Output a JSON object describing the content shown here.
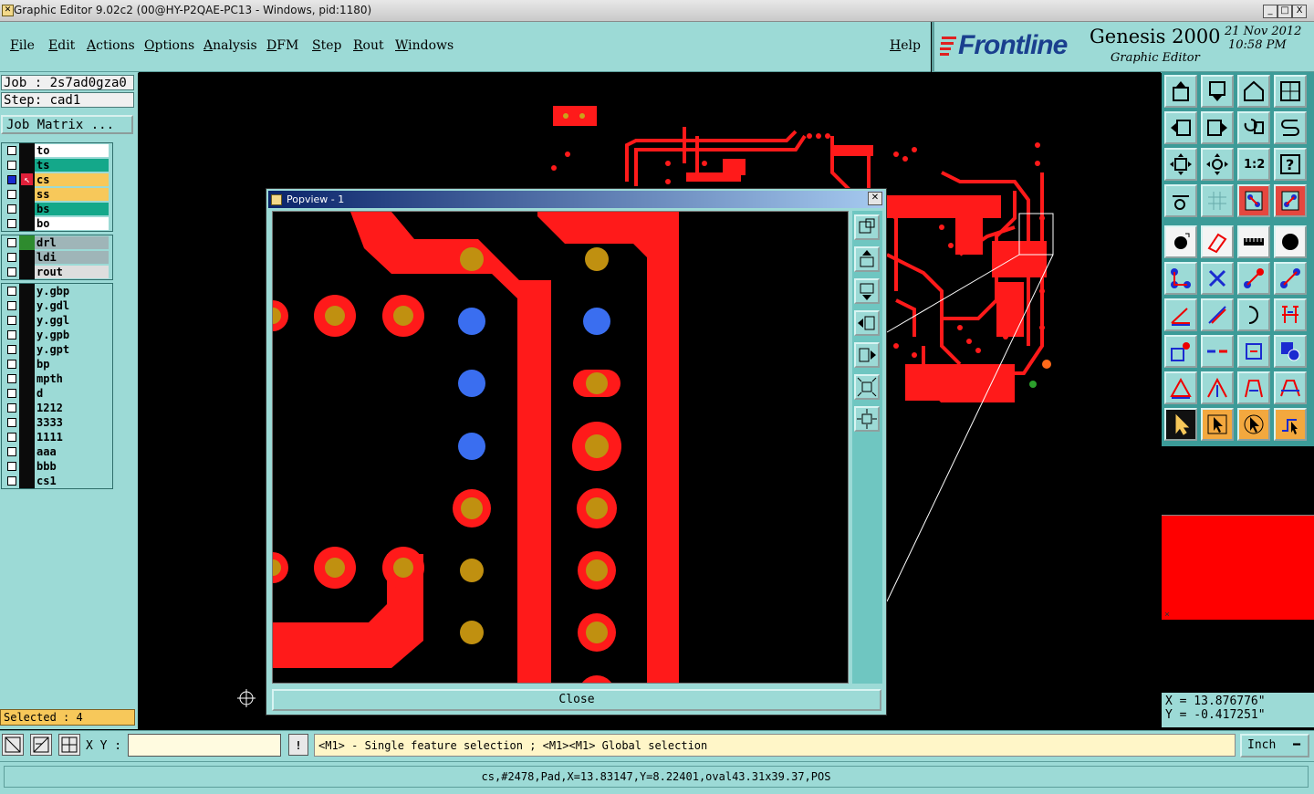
{
  "window": {
    "title": "Graphic Editor 9.02c2 (00@HY-P2QAE-PC13 - Windows, pid:1180)",
    "controls": [
      "_",
      "□",
      "X"
    ]
  },
  "menubar": {
    "items": [
      "File",
      "Edit",
      "Actions",
      "Options",
      "Analysis",
      "DFM",
      "Step",
      "Rout",
      "Windows"
    ],
    "help": "Help"
  },
  "brand": {
    "logo": "Frontline",
    "product": "Genesis 2000",
    "subtitle": "Graphic Editor",
    "date": "21 Nov 2012",
    "time": "10:58 PM"
  },
  "left_panel": {
    "job": "Job : 2s7ad0gza0",
    "step": "Step: cad1",
    "job_matrix": "Job Matrix ...",
    "layer_groups": [
      [
        {
          "name": "to",
          "color": "#ffffff",
          "checked": false
        },
        {
          "name": "ts",
          "color": "#14a88a",
          "checked": false
        },
        {
          "name": "cs",
          "color": "#f7c85a",
          "checked": true
        },
        {
          "name": "ss",
          "color": "#f7c85a",
          "checked": false
        },
        {
          "name": "bs",
          "color": "#14a88a",
          "checked": false
        },
        {
          "name": "bo",
          "color": "#ffffff",
          "checked": false
        }
      ],
      [
        {
          "name": "drl",
          "color": "#9fb5b8",
          "checked": false
        },
        {
          "name": "ldi",
          "color": "#9fb5b8",
          "checked": false
        },
        {
          "name": "rout",
          "color": "#dedede",
          "checked": false
        }
      ],
      [
        {
          "name": "y.gbp",
          "color": "#9cdad6",
          "checked": false
        },
        {
          "name": "y.gdl",
          "color": "#9cdad6",
          "checked": false
        },
        {
          "name": "y.ggl",
          "color": "#9cdad6",
          "checked": false
        },
        {
          "name": "y.gpb",
          "color": "#9cdad6",
          "checked": false
        },
        {
          "name": "y.gpt",
          "color": "#9cdad6",
          "checked": false
        },
        {
          "name": "bp",
          "color": "#9cdad6",
          "checked": false
        },
        {
          "name": "mpth",
          "color": "#9cdad6",
          "checked": false
        },
        {
          "name": "d",
          "color": "#9cdad6",
          "checked": false
        },
        {
          "name": "1212",
          "color": "#9cdad6",
          "checked": false
        },
        {
          "name": "3333",
          "color": "#9cdad6",
          "checked": false
        },
        {
          "name": "1111",
          "color": "#9cdad6",
          "checked": false
        },
        {
          "name": "aaa",
          "color": "#9cdad6",
          "checked": false
        },
        {
          "name": "bbb",
          "color": "#9cdad6",
          "checked": false
        },
        {
          "name": "cs1",
          "color": "#9cdad6",
          "checked": false
        }
      ]
    ],
    "selected": "Selected : 4"
  },
  "popview": {
    "title": "Popview - 1",
    "close_label": "Close"
  },
  "right_panel": {
    "x_coord": "X = 13.876776\"",
    "y_coord": "Y = -0.417251\"",
    "ratio_label": "1:2"
  },
  "bottom": {
    "xy_label": "X Y :",
    "xy_value": "",
    "message": "<M1> - Single feature selection ; <M1><M1> Global selection",
    "unit": "Inch"
  },
  "status": {
    "text": "cs,#2478,Pad,X=13.83147,Y=8.22401,oval43.31x39.37,POS"
  }
}
